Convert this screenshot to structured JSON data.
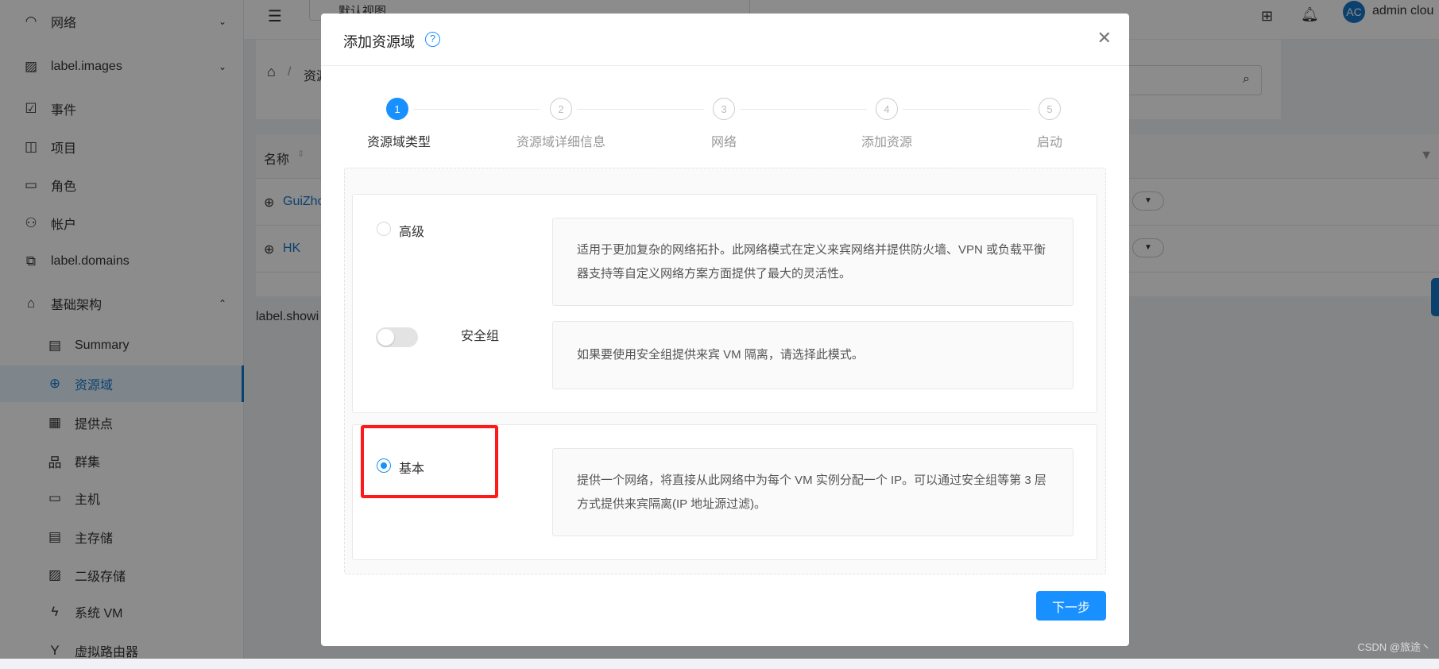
{
  "sidebar": {
    "items": [
      {
        "label": "网络",
        "icon": "wifi-icon",
        "chevron": "down"
      },
      {
        "label": "label.images",
        "icon": "image-icon",
        "chevron": "down"
      },
      {
        "label": "事件",
        "icon": "calendar-check-icon"
      },
      {
        "label": "项目",
        "icon": "project-icon"
      },
      {
        "label": "角色",
        "icon": "id-card-icon"
      },
      {
        "label": "帐户",
        "icon": "users-icon"
      },
      {
        "label": "label.domains",
        "icon": "block-icon"
      },
      {
        "label": "基础架构",
        "icon": "bank-icon",
        "chevron": "up"
      }
    ],
    "sub_items": [
      {
        "label": "Summary",
        "icon": "book-icon"
      },
      {
        "label": "资源域",
        "icon": "globe-icon",
        "active": true
      },
      {
        "label": "提供点",
        "icon": "appstore-icon"
      },
      {
        "label": "群集",
        "icon": "cluster-icon"
      },
      {
        "label": "主机",
        "icon": "desktop-icon"
      },
      {
        "label": "主存储",
        "icon": "database-icon"
      },
      {
        "label": "二级存储",
        "icon": "picture-icon"
      },
      {
        "label": "系统 VM",
        "icon": "thunderbolt-icon"
      },
      {
        "label": "虚拟路由器",
        "icon": "fork-icon"
      }
    ]
  },
  "header": {
    "view_select": "默认视图",
    "user_initials": "AC",
    "user_name": "admin clou"
  },
  "page": {
    "breadcrumb_current": "资源",
    "table_header_name": "名称",
    "rows": [
      {
        "name": "GuiZho"
      },
      {
        "name": "HK"
      }
    ],
    "footer_text": "label.showi"
  },
  "modal": {
    "title": "添加资源域",
    "steps": [
      {
        "num": "1",
        "label": "资源域类型"
      },
      {
        "num": "2",
        "label": "资源域详细信息"
      },
      {
        "num": "3",
        "label": "网络"
      },
      {
        "num": "4",
        "label": "添加资源"
      },
      {
        "num": "5",
        "label": "启动"
      }
    ],
    "current_step": 1,
    "options": {
      "advanced": {
        "label": "高级",
        "selected": false,
        "desc": "适用于更加复杂的网络拓扑。此网络模式在定义来宾网络并提供防火墙、VPN 或负载平衡器支持等自定义网络方案方面提供了最大的灵活性。"
      },
      "security_group": {
        "label": "安全组",
        "enabled": false,
        "desc": "如果要使用安全组提供来宾 VM 隔离，请选择此模式。"
      },
      "basic": {
        "label": "基本",
        "selected": true,
        "desc": "提供一个网络，将直接从此网络中为每个 VM 实例分配一个 IP。可以通过安全组等第 3 层方式提供来宾隔离(IP 地址源过滤)。"
      }
    },
    "next_label": "下一步",
    "accent": "#1890ff",
    "highlight_color": "#ff1a1a"
  },
  "watermark": "CSDN @旅途丶"
}
